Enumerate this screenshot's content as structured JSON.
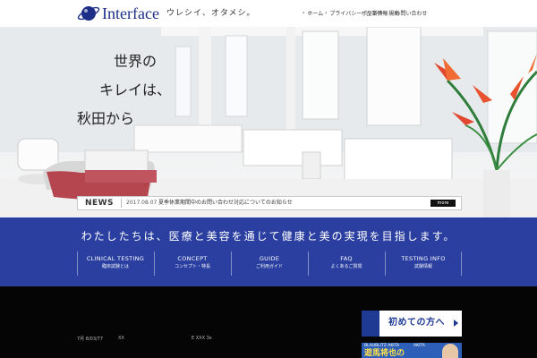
{
  "header": {
    "brand": "Interface",
    "tagline": "ウレシイ、オタメシ。",
    "nav": [
      {
        "label": "ホーム"
      },
      {
        "label": "プライバシーポリシー・規約"
      },
      {
        "label": "企業情報"
      },
      {
        "label": "お問い合わせ"
      }
    ]
  },
  "hero": {
    "copy_lines": [
      "世界の",
      "キレイは、",
      "秋田から"
    ]
  },
  "news": {
    "label": "NEWS",
    "date": "2017.08.07",
    "title": "夏季休業期間中のお問い合わせ対応についてのお知らせ",
    "more": "more"
  },
  "mission": {
    "text": "わたしたちは、医療と美容を通じて健康と美の実現を目指します。",
    "nav": [
      {
        "en": "CLINICAL TESTING",
        "ja": "臨床試験とは"
      },
      {
        "en": "CONCEPT",
        "ja": "コンセプト・特長"
      },
      {
        "en": "GUIDE",
        "ja": "ご利用ガイド"
      },
      {
        "en": "FAQ",
        "ja": "よくあるご質問"
      },
      {
        "en": "TESTING INFO",
        "ja": "試験情報"
      }
    ]
  },
  "footer": {
    "rows": [
      "7月 8/03/77",
      "XX",
      "E XXX 3x"
    ],
    "banner1": "初めての方へ",
    "banner2_small": "BLAUBLITZ AKITA",
    "banner2_big": "遊馬将也の",
    "banner2_tag": "AKITA"
  },
  "colors": {
    "brand": "#1c2e86",
    "mission_bg": "#2a3fa0",
    "footer_bg": "#050505"
  }
}
